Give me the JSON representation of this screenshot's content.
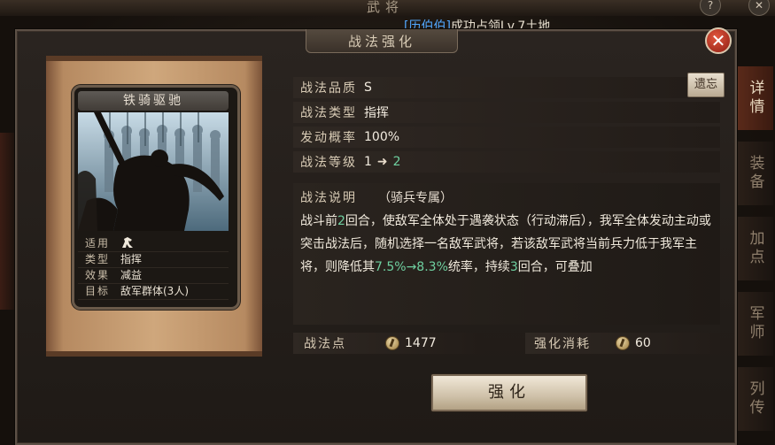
{
  "background": {
    "top_title": "武将",
    "notice": {
      "tag": "[历伯伯]",
      "text": "成功占领Lv.7土地"
    },
    "side_tabs": [
      "详情",
      "装备",
      "加点",
      "军师",
      "列传"
    ],
    "top_buttons": [
      "?",
      "✕"
    ]
  },
  "dialog": {
    "title": "战法强化",
    "close_icon": "✕"
  },
  "card": {
    "name": "铁骑驱驰",
    "info": [
      {
        "label": "适用",
        "value": "",
        "icon": "cavalry-horse-icon"
      },
      {
        "label": "类型",
        "value": "指挥"
      },
      {
        "label": "效果",
        "value": "减益"
      },
      {
        "label": "目标",
        "value": "敌军群体(3人)"
      }
    ]
  },
  "details": {
    "quality_label": "战法品质",
    "quality_value": "S",
    "appraise_button": "遗忘",
    "type_label": "战法类型",
    "type_value": "指挥",
    "rate_label": "发动概率",
    "rate_value": "100%",
    "level_label": "战法等级",
    "level_from": "1",
    "level_arrow": "➜",
    "level_to": "2",
    "desc_label": "战法说明",
    "desc_sub": "（骑兵专属）",
    "desc_parts": [
      {
        "t": "战斗前",
        "c": "normal"
      },
      {
        "t": "2",
        "c": "num"
      },
      {
        "t": "回合，使敌军全体处于遇袭状态（行动滞后），我军全体发动主动或突击战法后，随机选择一名敌军武将，若该敌军武将当前兵力低于我军主将，则降低其",
        "c": "normal"
      },
      {
        "t": "7.5%→8.3%",
        "c": "num"
      },
      {
        "t": "统率，持续",
        "c": "normal"
      },
      {
        "t": "3",
        "c": "num"
      },
      {
        "t": "回合，可叠加",
        "c": "normal"
      }
    ]
  },
  "points": {
    "label": "战法点",
    "value": "1477",
    "cost_label": "强化消耗",
    "cost_value": "60"
  },
  "upgrade_button": "强化",
  "colors": {
    "highlight_green": "#6fd0a0",
    "notice_blue": "#52a8ff",
    "close_red": "#c0392b"
  }
}
